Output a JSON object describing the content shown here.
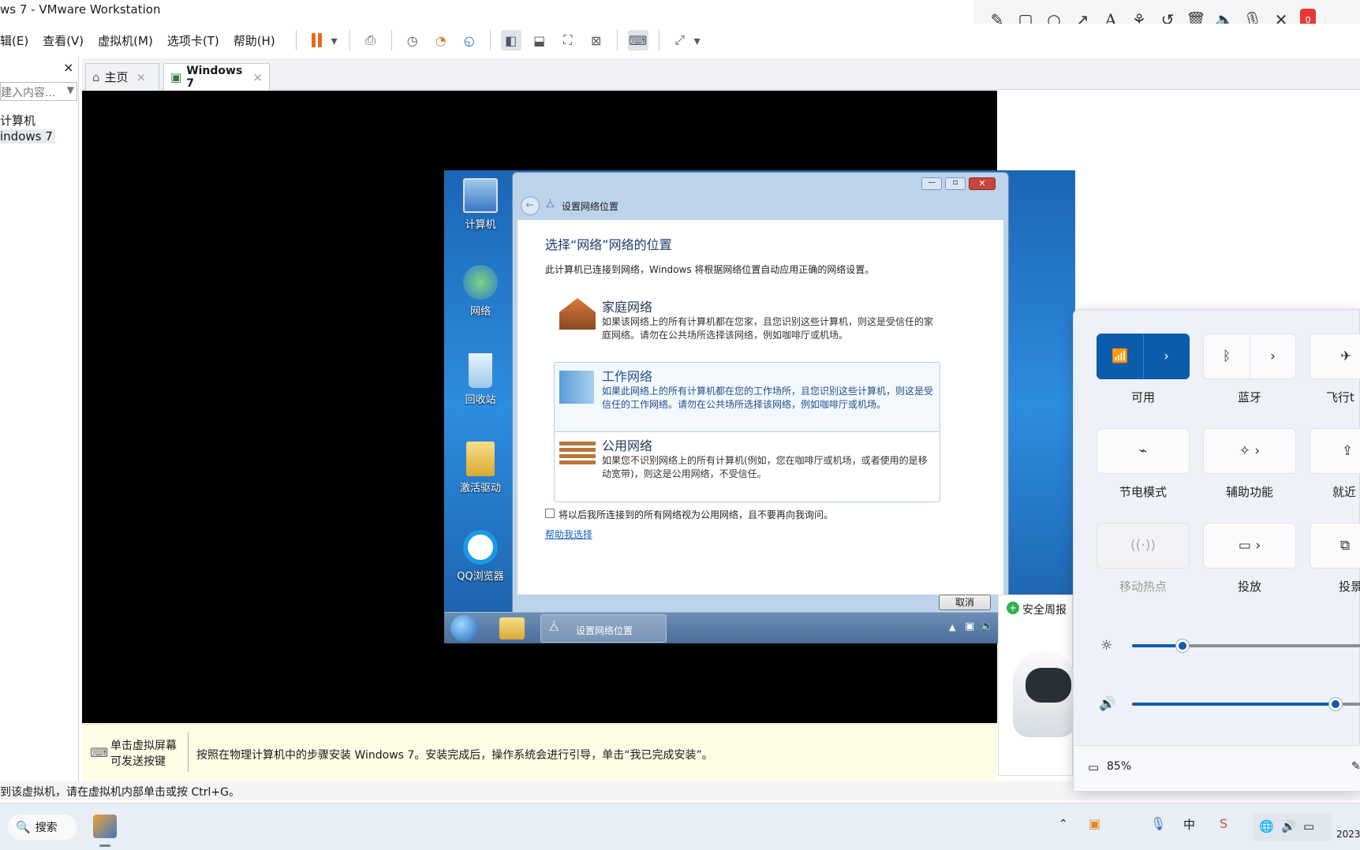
{
  "vmware": {
    "title": "ws 7 - VMware Workstation",
    "menus": [
      "辑(E)",
      "查看(V)",
      "虚拟机(M)",
      "选项卡(T)",
      "帮助(H)"
    ],
    "library_close": "×",
    "library_search_placeholder": "建入内容...",
    "tree": [
      "计算机",
      "indows 7"
    ],
    "tabs": [
      {
        "label": "主页",
        "close": "×"
      },
      {
        "label": "Windows 7",
        "close": "×"
      }
    ],
    "hint_title_1": "单击虚拟屏幕",
    "hint_title_2": "可发送按键",
    "hint_text": "按照在物理计算机中的步骤安装 Windows 7。安装完成后，操作系统会进行引导，单击“我已完成安装”。",
    "status_text": "到该虚拟机，请在虚拟机内部单击或按 Ctrl+G。"
  },
  "win7": {
    "desktop_icons": [
      "计算机",
      "网络",
      "回收站",
      "激活驱动",
      "QQ浏览器"
    ],
    "dialog": {
      "breadcrumb": "设置网络位置",
      "heading": "选择“网络”网络的位置",
      "intro": "此计算机已连接到网络，Windows 将根据网络位置自动应用正确的网络设置。",
      "options": [
        {
          "title": "家庭网络",
          "desc": "如果该网络上的所有计算机都在您家，且您识别这些计算机，则这是受信任的家庭网络。请勿在公共场所选择该网络，例如咖啡厅或机场。"
        },
        {
          "title": "工作网络",
          "desc": "如果此网络上的所有计算机都在您的工作场所，且您识别这些计算机，则这是受信任的工作网络。请勿在公共场所选择该网络，例如咖啡厅或机场。"
        },
        {
          "title": "公用网络",
          "desc": "如果您不识别网络上的所有计算机(例如，您在咖啡厅或机场，或者使用的是移动宽带)，则这是公用网络，不受信任。"
        }
      ],
      "checkbox": "将以后我所连接到的所有网络视为公用网络，且不要再向我询问。",
      "help_link": "帮助我选择",
      "cancel": "取消"
    },
    "taskbar_item": "设置网络位置"
  },
  "notification": {
    "title": "安全周报"
  },
  "quick_settings": {
    "tiles": [
      {
        "label": "可用",
        "icon": "wifi-icon"
      },
      {
        "label": "蓝牙",
        "icon": "bluetooth-icon"
      },
      {
        "label": "飞行t",
        "icon": "airplane-icon"
      },
      {
        "label": "节电模式",
        "icon": "battery-saver-icon"
      },
      {
        "label": "辅助功能",
        "icon": "accessibility-icon"
      },
      {
        "label": "就近",
        "icon": "nearby-share-icon"
      },
      {
        "label": "移动热点",
        "icon": "hotspot-icon"
      },
      {
        "label": "投放",
        "icon": "cast-icon"
      },
      {
        "label": "投景",
        "icon": "project-icon"
      }
    ],
    "brightness": 0.22,
    "volume": 0.89,
    "battery": "85%"
  },
  "taskbar": {
    "search": "搜索",
    "clock": "2023"
  },
  "colors": {
    "accent": "#0b5cad",
    "vm_bg": "#000000",
    "win7_blue": "#2d8de0"
  }
}
